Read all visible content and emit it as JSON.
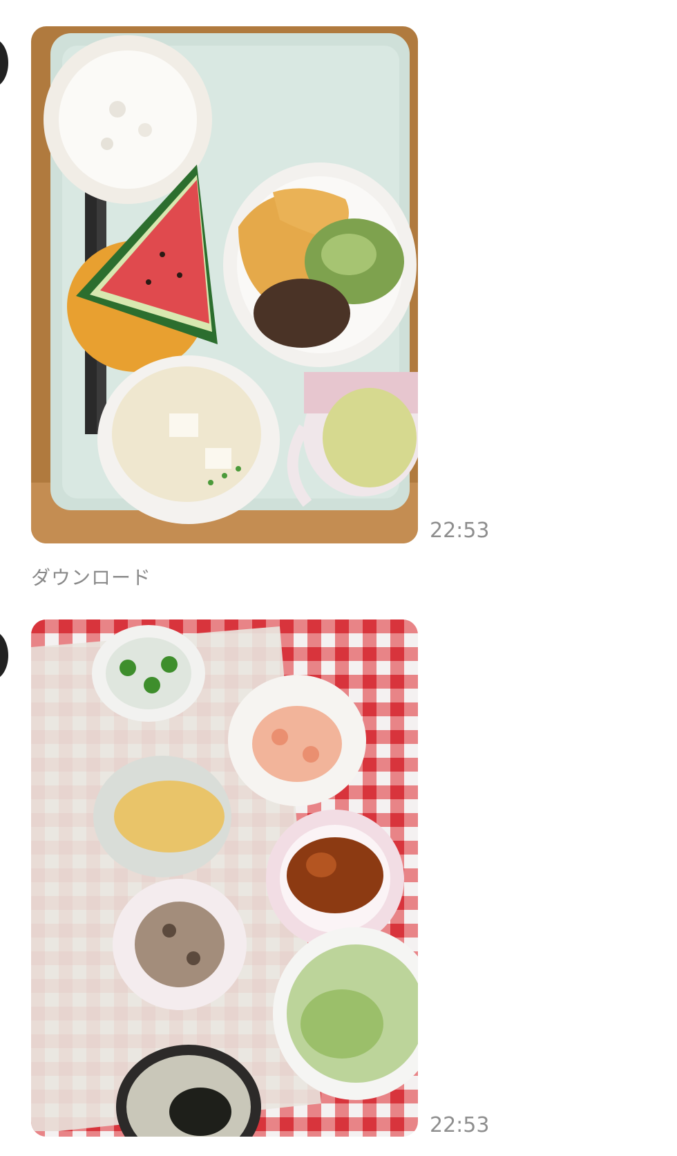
{
  "messages": [
    {
      "image_icon": "photo-meal-tray",
      "time": "22:53",
      "download_label": "ダウンロード"
    },
    {
      "image_icon": "photo-meal-table",
      "time": "22:53"
    }
  ],
  "colors": {
    "avatar": "#222222",
    "timestamp": "#8e8e8e",
    "download": "#8a8a8a",
    "background": "#ffffff"
  }
}
